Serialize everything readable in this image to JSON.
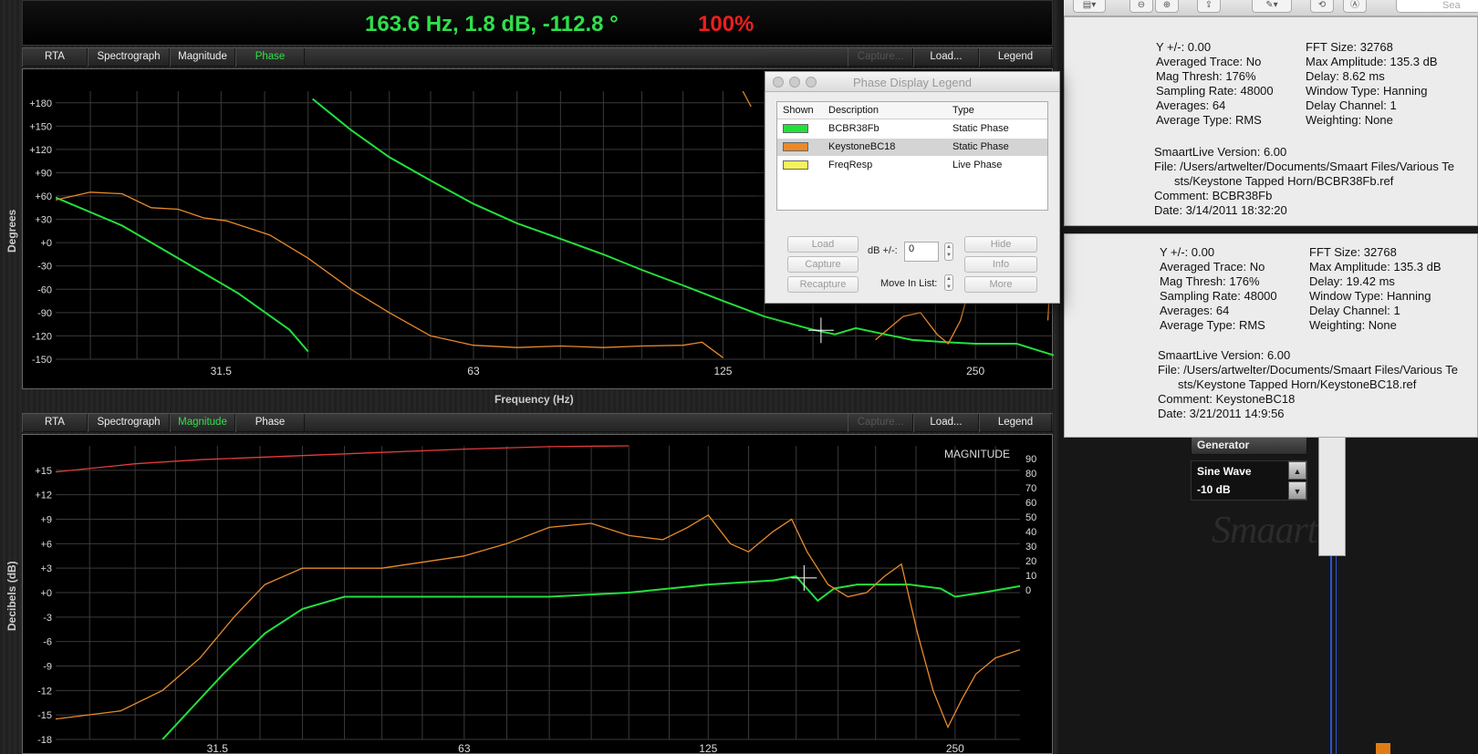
{
  "readout": {
    "value": "163.6 Hz, 1.8 dB, -112.8 °",
    "percent": "100%"
  },
  "toolbars": {
    "tabs": [
      "RTA",
      "Spectrograph",
      "Magnitude",
      "Phase"
    ],
    "capture": "Capture...",
    "load": "Load...",
    "legend": "Legend"
  },
  "phase_plot": {
    "ylabel": "Degrees",
    "xlabel": "Frequency (Hz)",
    "yticks": [
      "+180",
      "+150",
      "+120",
      "+90",
      "+60",
      "+30",
      "+0",
      "-30",
      "-60",
      "-90",
      "-120",
      "-150"
    ],
    "xticks": [
      "31.5",
      "63",
      "125",
      "250"
    ]
  },
  "mag_plot": {
    "ylabel": "Decibels (dB)",
    "tag": "MAGNITUDE",
    "yticks": [
      "+15",
      "+12",
      "+9",
      "+6",
      "+3",
      "+0",
      "-3",
      "-6",
      "-9",
      "-12",
      "-15",
      "-18"
    ],
    "yticks_right": [
      "90",
      "80",
      "70",
      "60",
      "50",
      "40",
      "30",
      "20",
      "10",
      "0"
    ],
    "xticks": [
      "31.5",
      "63",
      "125",
      "250"
    ]
  },
  "chart_data": [
    {
      "type": "line",
      "xscale": "log",
      "xlim": [
        20,
        310
      ],
      "ylim": [
        -150,
        195
      ],
      "xlabel": "Frequency (Hz)",
      "ylabel": "Degrees",
      "series": [
        {
          "name": "BCBR38Fb",
          "color": "#22e03c",
          "segments": [
            [
              [
                20,
                58
              ],
              [
                24,
                22
              ],
              [
                28,
                -20
              ],
              [
                33,
                -65
              ],
              [
                38,
                -112
              ],
              [
                40,
                -140
              ]
            ],
            [
              [
                40.5,
                185
              ],
              [
                45,
                145
              ],
              [
                50,
                110
              ],
              [
                56,
                80
              ],
              [
                63,
                50
              ],
              [
                71,
                25
              ],
              [
                80,
                5
              ],
              [
                90,
                -15
              ],
              [
                100,
                -35
              ],
              [
                112,
                -55
              ],
              [
                125,
                -75
              ],
              [
                140,
                -95
              ],
              [
                155,
                -108
              ],
              [
                160,
                -112
              ],
              [
                170,
                -118
              ],
              [
                180,
                -110
              ],
              [
                195,
                -118
              ],
              [
                210,
                -125
              ],
              [
                230,
                -128
              ],
              [
                250,
                -130
              ],
              [
                280,
                -130
              ],
              [
                310,
                -145
              ]
            ]
          ]
        },
        {
          "name": "KeystoneBC18",
          "color": "#e98a2a",
          "segments": [
            [
              [
                20,
                55
              ],
              [
                22,
                65
              ],
              [
                24,
                63
              ],
              [
                26,
                45
              ],
              [
                28,
                43
              ],
              [
                30,
                32
              ],
              [
                32,
                28
              ],
              [
                36,
                10
              ],
              [
                40,
                -20
              ],
              [
                45,
                -60
              ],
              [
                50,
                -90
              ],
              [
                56,
                -120
              ],
              [
                63,
                -132
              ],
              [
                71,
                -135
              ],
              [
                80,
                -133
              ],
              [
                90,
                -135
              ],
              [
                100,
                -133
              ],
              [
                112,
                -132
              ],
              [
                118,
                -128
              ],
              [
                125,
                -148
              ]
            ],
            [
              [
                132,
                195
              ],
              [
                135,
                175
              ]
            ],
            [
              [
                190,
                -125
              ],
              [
                205,
                -95
              ],
              [
                215,
                -90
              ],
              [
                225,
                -118
              ],
              [
                232,
                -130
              ],
              [
                240,
                -100
              ],
              [
                250,
                -30
              ],
              [
                258,
                60
              ],
              [
                262,
                190
              ]
            ],
            [
              [
                305,
                -100
              ],
              [
                310,
                25
              ]
            ]
          ]
        }
      ]
    },
    {
      "type": "line",
      "xscale": "log",
      "xlim": [
        20,
        300
      ],
      "ylim": [
        -18,
        18
      ],
      "ylabel": "Decibels (dB)",
      "series": [
        {
          "name": "BCBR38Fb",
          "color": "#22e03c",
          "points": [
            [
              27,
              -18
            ],
            [
              32,
              -10
            ],
            [
              36,
              -5
            ],
            [
              40,
              -2
            ],
            [
              45,
              -0.5
            ],
            [
              50,
              -0.5
            ],
            [
              63,
              -0.5
            ],
            [
              80,
              -0.5
            ],
            [
              100,
              0
            ],
            [
              125,
              1
            ],
            [
              150,
              1.5
            ],
            [
              160,
              2
            ],
            [
              170,
              -1
            ],
            [
              178,
              0.5
            ],
            [
              190,
              1
            ],
            [
              220,
              1
            ],
            [
              240,
              0.5
            ],
            [
              250,
              -0.5
            ],
            [
              270,
              0
            ],
            [
              300,
              0.8
            ]
          ]
        },
        {
          "name": "KeystoneBC18",
          "color": "#e98a2a",
          "points": [
            [
              20,
              -15.5
            ],
            [
              24,
              -14.5
            ],
            [
              27,
              -12
            ],
            [
              30,
              -8
            ],
            [
              33,
              -3
            ],
            [
              36,
              1
            ],
            [
              40,
              3
            ],
            [
              45,
              3
            ],
            [
              50,
              3
            ],
            [
              63,
              4.5
            ],
            [
              71,
              6
            ],
            [
              80,
              8
            ],
            [
              90,
              8.5
            ],
            [
              100,
              7
            ],
            [
              110,
              6.5
            ],
            [
              118,
              8
            ],
            [
              125,
              9.5
            ],
            [
              133,
              6
            ],
            [
              140,
              5
            ],
            [
              150,
              7.5
            ],
            [
              158,
              9
            ],
            [
              165,
              5
            ],
            [
              175,
              1
            ],
            [
              185,
              -0.5
            ],
            [
              195,
              0
            ],
            [
              205,
              2
            ],
            [
              215,
              3.5
            ],
            [
              225,
              -5
            ],
            [
              235,
              -12
            ],
            [
              245,
              -16.5
            ],
            [
              255,
              -13
            ],
            [
              265,
              -10
            ],
            [
              280,
              -8
            ],
            [
              300,
              -7
            ]
          ]
        },
        {
          "name": "FreqResp",
          "color": "#e33b3b",
          "points": [
            [
              20,
              14.8
            ],
            [
              25,
              15.8
            ],
            [
              30,
              16.3
            ],
            [
              40,
              16.8
            ],
            [
              50,
              17.2
            ],
            [
              63,
              17.6
            ],
            [
              80,
              17.9
            ],
            [
              100,
              18
            ]
          ]
        }
      ]
    }
  ],
  "legend_window": {
    "title": "Phase Display Legend",
    "columns": [
      "Shown",
      "Description",
      "Type"
    ],
    "rows": [
      {
        "color": "#22e03c",
        "description": "BCBR38Fb",
        "type": "Static Phase"
      },
      {
        "color": "#e98a2a",
        "description": "KeystoneBC18",
        "type": "Static Phase"
      },
      {
        "color": "#f2f25a",
        "description": "FreqResp",
        "type": "Live Phase"
      }
    ],
    "buttons": {
      "load": "Load",
      "capture": "Capture",
      "recapture": "Recapture",
      "hide": "Hide",
      "info": "Info",
      "more": "More"
    },
    "db_label": "dB +/-:",
    "db_value": "0",
    "move_label": "Move In List:"
  },
  "info_panel_1": {
    "left": [
      "Y +/-: 0.00",
      "Averaged Trace: No",
      "Mag Thresh: 176%",
      "Sampling Rate: 48000",
      "Averages: 64",
      "Average Type: RMS"
    ],
    "right": [
      "FFT Size: 32768",
      "Max Amplitude: 135.3 dB",
      "Delay: 8.62 ms",
      "Window Type: Hanning",
      "Delay Channel: 1",
      "Weighting: None"
    ],
    "version": "SmaartLive Version: 6.00",
    "file1": "File: /Users/artwelter/Documents/Smaart Files/Various Te",
    "file2": "sts/Keystone Tapped Horn/BCBR38Fb.ref",
    "comment": "Comment: BCBR38Fb",
    "date": "Date:  3/14/2011 18:32:20"
  },
  "info_panel_2": {
    "left": [
      "Y +/-: 0.00",
      "Averaged Trace: No",
      "Mag Thresh: 176%",
      "Sampling Rate: 48000",
      "Averages: 64",
      "Average Type: RMS"
    ],
    "right": [
      "FFT Size: 32768",
      "Max Amplitude: 135.3 dB",
      "Delay: 19.42 ms",
      "Window Type: Hanning",
      "Delay Channel: 1",
      "Weighting: None"
    ],
    "version": "SmaartLive Version: 6.00",
    "file1": "File: /Users/artwelter/Documents/Smaart Files/Various Te",
    "file2": "sts/Keystone Tapped Horn/KeystoneBC18.ref",
    "comment": "Comment: KeystoneBC18",
    "date": "Date:  3/21/2011 14:9:56"
  },
  "generator": {
    "label": "Generator",
    "signal": "Sine Wave",
    "level": "-10 dB"
  },
  "logo": "Smaart",
  "search_placeholder": "Sea"
}
